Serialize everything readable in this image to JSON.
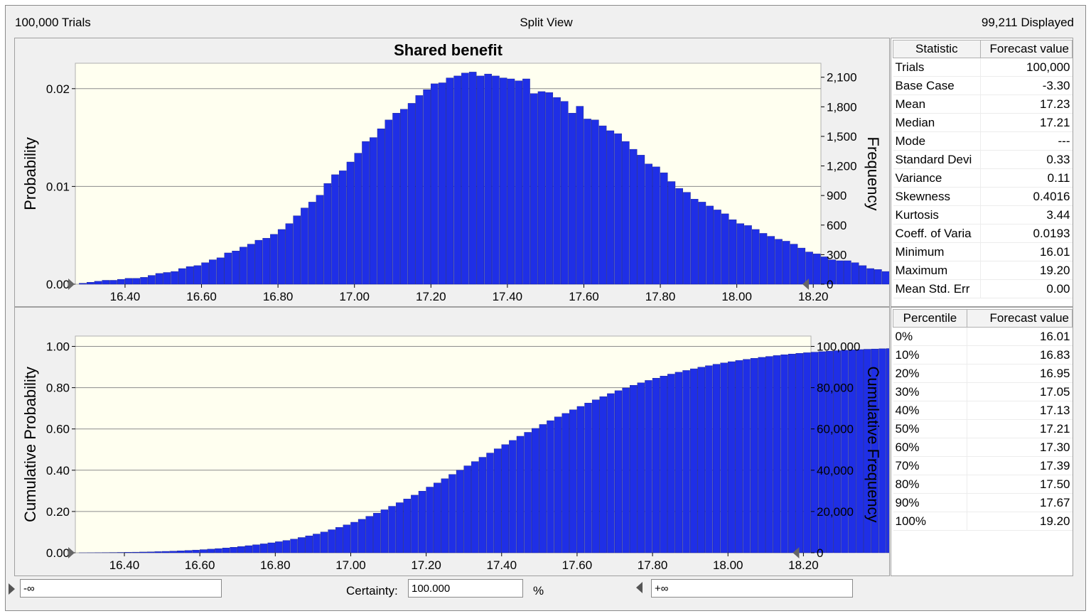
{
  "header": {
    "trials": "100,000 Trials",
    "view": "Split View",
    "displayed": "99,211 Displayed"
  },
  "colors": {
    "bar": "#1f2fe6",
    "plot_bg": "#fffff0"
  },
  "histogram": {
    "title": "Shared benefit",
    "ylabel_left": "Probability",
    "ylabel_right": "Frequency",
    "y_left_ticks": [
      "0.02",
      "0.01",
      "0.00"
    ],
    "y_right_ticks": [
      "2,100",
      "1,800",
      "1,500",
      "1,200",
      "900",
      "600",
      "300",
      "0"
    ],
    "x_ticks": [
      "16.40",
      "16.60",
      "16.80",
      "17.00",
      "17.20",
      "17.40",
      "17.60",
      "17.80",
      "18.00",
      "18.20"
    ]
  },
  "cumulative": {
    "ylabel_left": "Cumulative Probability",
    "ylabel_right": "Cumulative Frequency",
    "y_left_ticks": [
      "1.00",
      "0.80",
      "0.60",
      "0.40",
      "0.20",
      "0.00"
    ],
    "y_right_ticks": [
      "100,000",
      "80,000",
      "60,000",
      "40,000",
      "20,000",
      "0"
    ],
    "x_ticks": [
      "16.40",
      "16.60",
      "16.80",
      "17.00",
      "17.20",
      "17.40",
      "17.60",
      "17.80",
      "18.00",
      "18.20"
    ]
  },
  "stats_table": {
    "headers": [
      "Statistic",
      "Forecast value"
    ],
    "rows": [
      [
        "Trials",
        "100,000"
      ],
      [
        "Base Case",
        "-3.30"
      ],
      [
        "Mean",
        "17.23"
      ],
      [
        "Median",
        "17.21"
      ],
      [
        "Mode",
        "---"
      ],
      [
        "Standard Devi",
        "0.33"
      ],
      [
        "Variance",
        "0.11"
      ],
      [
        "Skewness",
        "0.4016"
      ],
      [
        "Kurtosis",
        "3.44"
      ],
      [
        "Coeff. of Varia",
        "0.0193"
      ],
      [
        "Minimum",
        "16.01"
      ],
      [
        "Maximum",
        "19.20"
      ],
      [
        "Mean Std. Err",
        "0.00"
      ]
    ]
  },
  "percentile_table": {
    "headers": [
      "Percentile",
      "Forecast value"
    ],
    "rows": [
      [
        "0%",
        "16.01"
      ],
      [
        "10%",
        "16.83"
      ],
      [
        "20%",
        "16.95"
      ],
      [
        "30%",
        "17.05"
      ],
      [
        "40%",
        "17.13"
      ],
      [
        "50%",
        "17.21"
      ],
      [
        "60%",
        "17.30"
      ],
      [
        "70%",
        "17.39"
      ],
      [
        "80%",
        "17.50"
      ],
      [
        "90%",
        "17.67"
      ],
      [
        "100%",
        "19.20"
      ]
    ]
  },
  "bottom": {
    "left_value": "-∞",
    "certainty_label": "Certainty:",
    "certainty_value": "100.000",
    "percent": "%",
    "right_value": "+∞"
  },
  "chart_data": [
    {
      "type": "bar",
      "title": "Shared benefit",
      "xlabel": "",
      "ylabel": "Probability",
      "y2label": "Frequency",
      "xlim": [
        16.27,
        18.22
      ],
      "ylim": [
        0,
        0.0226
      ],
      "bin_width": 0.02,
      "x_start": 16.29,
      "values": [
        0.0001,
        0.0002,
        0.0003,
        0.0004,
        0.0004,
        0.0005,
        0.0006,
        0.0006,
        0.0007,
        0.0009,
        0.0011,
        0.0012,
        0.0013,
        0.0016,
        0.0018,
        0.0019,
        0.0022,
        0.0025,
        0.0027,
        0.0032,
        0.0034,
        0.0038,
        0.0041,
        0.0045,
        0.0047,
        0.0051,
        0.0056,
        0.0062,
        0.007,
        0.0078,
        0.0084,
        0.0091,
        0.0103,
        0.0112,
        0.0116,
        0.0125,
        0.0134,
        0.0146,
        0.015,
        0.0159,
        0.0168,
        0.0175,
        0.0179,
        0.0185,
        0.0193,
        0.0199,
        0.0205,
        0.0206,
        0.0211,
        0.0213,
        0.0216,
        0.0217,
        0.0213,
        0.0215,
        0.0213,
        0.0211,
        0.021,
        0.0208,
        0.021,
        0.0195,
        0.0197,
        0.0196,
        0.0191,
        0.0187,
        0.0175,
        0.0182,
        0.0169,
        0.0168,
        0.0162,
        0.0157,
        0.0154,
        0.0146,
        0.0138,
        0.0132,
        0.0123,
        0.012,
        0.0114,
        0.0105,
        0.0098,
        0.0094,
        0.0087,
        0.0084,
        0.008,
        0.0076,
        0.0072,
        0.0066,
        0.0062,
        0.006,
        0.0056,
        0.0052,
        0.0049,
        0.0046,
        0.0044,
        0.0041,
        0.0037,
        0.0033,
        0.0031,
        0.0028,
        0.0025,
        0.0024,
        0.0024,
        0.0022,
        0.0019,
        0.0016,
        0.0015,
        0.0013,
        0.0012,
        0.001,
        0.0009,
        0.0008,
        0.0008
      ]
    },
    {
      "type": "bar",
      "title": "",
      "xlabel": "",
      "ylabel": "Cumulative Probability",
      "y2label": "Cumulative Frequency",
      "xlim": [
        16.27,
        18.22
      ],
      "ylim": [
        0,
        1.05
      ],
      "bin_width": 0.02,
      "x_start": 16.29,
      "cumulative_of_series": 0,
      "final_value": 0.992
    }
  ]
}
